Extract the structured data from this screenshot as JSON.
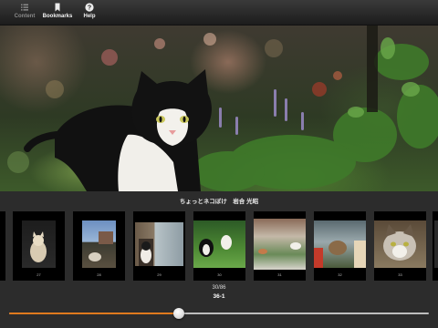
{
  "toolbar": {
    "contents_label": "Content",
    "bookmarks_label": "Bookmarks",
    "help_label": "Help"
  },
  "photo": {
    "subject": "cat-photo"
  },
  "caption": "ちょっとネコぼけ　岩合 光昭",
  "thumbnails": [
    {
      "page": "26"
    },
    {
      "page": "27"
    },
    {
      "page": "28"
    },
    {
      "page": "29"
    },
    {
      "page": "30"
    },
    {
      "page": "31"
    },
    {
      "page": "32"
    },
    {
      "page": "33"
    }
  ],
  "page_indicator": {
    "count": "30/86",
    "label": "36-1"
  },
  "slider": {
    "progress": 0.405
  },
  "colors": {
    "accent": "#e07a1e",
    "toolbar": "#2a2a2a",
    "background": "#2c2c2c"
  }
}
